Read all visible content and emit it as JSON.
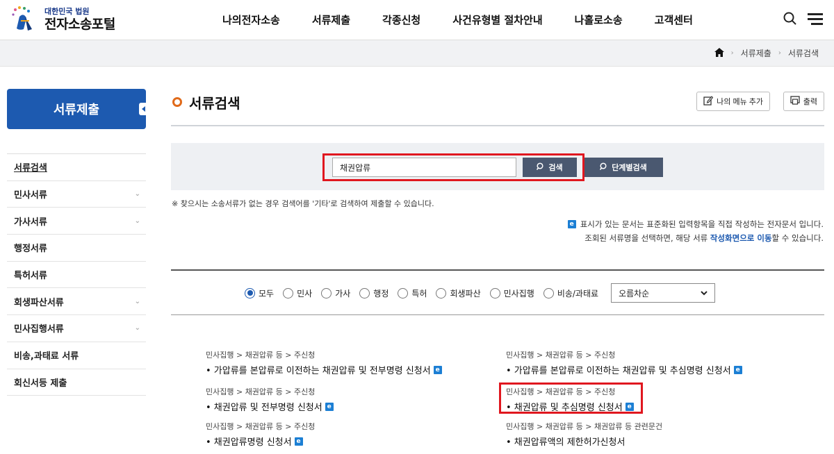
{
  "header": {
    "logo_sub": "대한민국 법원",
    "logo_main": "전자소송포털",
    "nav": [
      "나의전자소송",
      "서류제출",
      "각종신청",
      "사건유형별 절차안내",
      "나홀로소송",
      "고객센터"
    ]
  },
  "breadcrumb": [
    "서류제출",
    "서류검색"
  ],
  "sidebar": {
    "title": "서류제출",
    "items": [
      {
        "label": "서류검색",
        "chevron": ""
      },
      {
        "label": "민사서류",
        "chevron": "⌄"
      },
      {
        "label": "가사서류",
        "chevron": "⌄"
      },
      {
        "label": "행정서류",
        "chevron": ""
      },
      {
        "label": "특허서류",
        "chevron": ""
      },
      {
        "label": "회생파산서류",
        "chevron": "⌄"
      },
      {
        "label": "민사집행서류",
        "chevron": "⌄"
      },
      {
        "label": "비송,과태료 서류",
        "chevron": ""
      },
      {
        "label": "회신서등 제출",
        "chevron": ""
      }
    ]
  },
  "page": {
    "title": "서류검색",
    "my_menu_label": "나의 메뉴 추가",
    "print_label": "출력"
  },
  "search": {
    "value": "채권압류",
    "search_label": "검색",
    "step_search_label": "단계별검색"
  },
  "notice": "※ 찾으시는 소송서류가 없는 경우 검색어를 '기타'로 검색하여 제출할 수 있습니다.",
  "info": {
    "line1": "표시가 있는 문서는 표준화된 입력항목을 직접 작성하는 전자문서 입니다.",
    "line2_before": "조회된 서류명을 선택하면, 해당 서류 ",
    "line2_link": "작성화면으로 이동",
    "line2_after": "할 수 있습니다.",
    "e_badge": "e"
  },
  "filters": {
    "options": [
      "모두",
      "민사",
      "가사",
      "행정",
      "특허",
      "회생파산",
      "민사집행",
      "비송/과태료"
    ],
    "selected": 0,
    "sort_value": "오름차순"
  },
  "results": [
    {
      "path": "민사집행 > 채권압류 등 > 주신청",
      "doc": "가압류를 본압류로 이전하는 채권압류 및 전부명령 신청서",
      "e": true
    },
    {
      "path": "민사집행 > 채권압류 등 > 주신청",
      "doc": "가압류를 본압류로 이전하는 채권압류 및 추심명령 신청서",
      "e": true
    },
    {
      "path": "민사집행 > 채권압류 등 > 주신청",
      "doc": "채권압류 및 전부명령 신청서",
      "e": true
    },
    {
      "path": "민사집행 > 채권압류 등 > 주신청",
      "doc": "채권압류 및 추심명령 신청서",
      "e": true
    },
    {
      "path": "민사집행 > 채권압류 등 > 주신청",
      "doc": "채권압류명령 신청서",
      "e": true
    },
    {
      "path": "민사집행 > 채권압류 등 > 채권압류 등 관련문건",
      "doc": "채권압류액의 제한허가신청서",
      "e": false
    }
  ],
  "colors": {
    "primary": "#1d5ab0",
    "button_dark": "#4a5870",
    "highlight": "#e0171f",
    "title_dot": "#e06a1a"
  }
}
